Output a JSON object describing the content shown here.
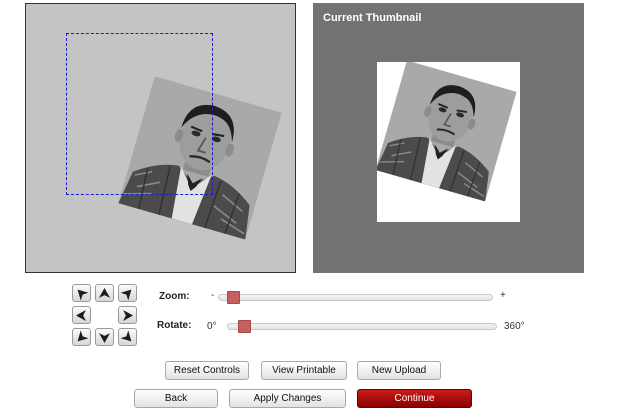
{
  "thumbnail": {
    "title": "Current Thumbnail"
  },
  "controls": {
    "zoom": {
      "label": "Zoom:",
      "min_label": "-",
      "max_label": "+",
      "value_fraction": 0.03
    },
    "rotate": {
      "label": "Rotate:",
      "min_label": "0°",
      "max_label": "360°",
      "value_fraction": 0.04
    },
    "arrows": [
      "arrow-up-left",
      "arrow-up",
      "arrow-up-right",
      "arrow-left",
      "arrow-right",
      "arrow-down-left",
      "arrow-down",
      "arrow-down-right"
    ]
  },
  "buttons": {
    "reset": "Reset Controls",
    "printable": "View Printable",
    "upload": "New Upload",
    "back": "Back",
    "apply": "Apply Changes",
    "continue": "Continue"
  },
  "colors": {
    "accent": "#b00000",
    "slider_thumb": "#c66060",
    "crop_outline": "#1a1ad6",
    "preview_bg": "#737373"
  }
}
